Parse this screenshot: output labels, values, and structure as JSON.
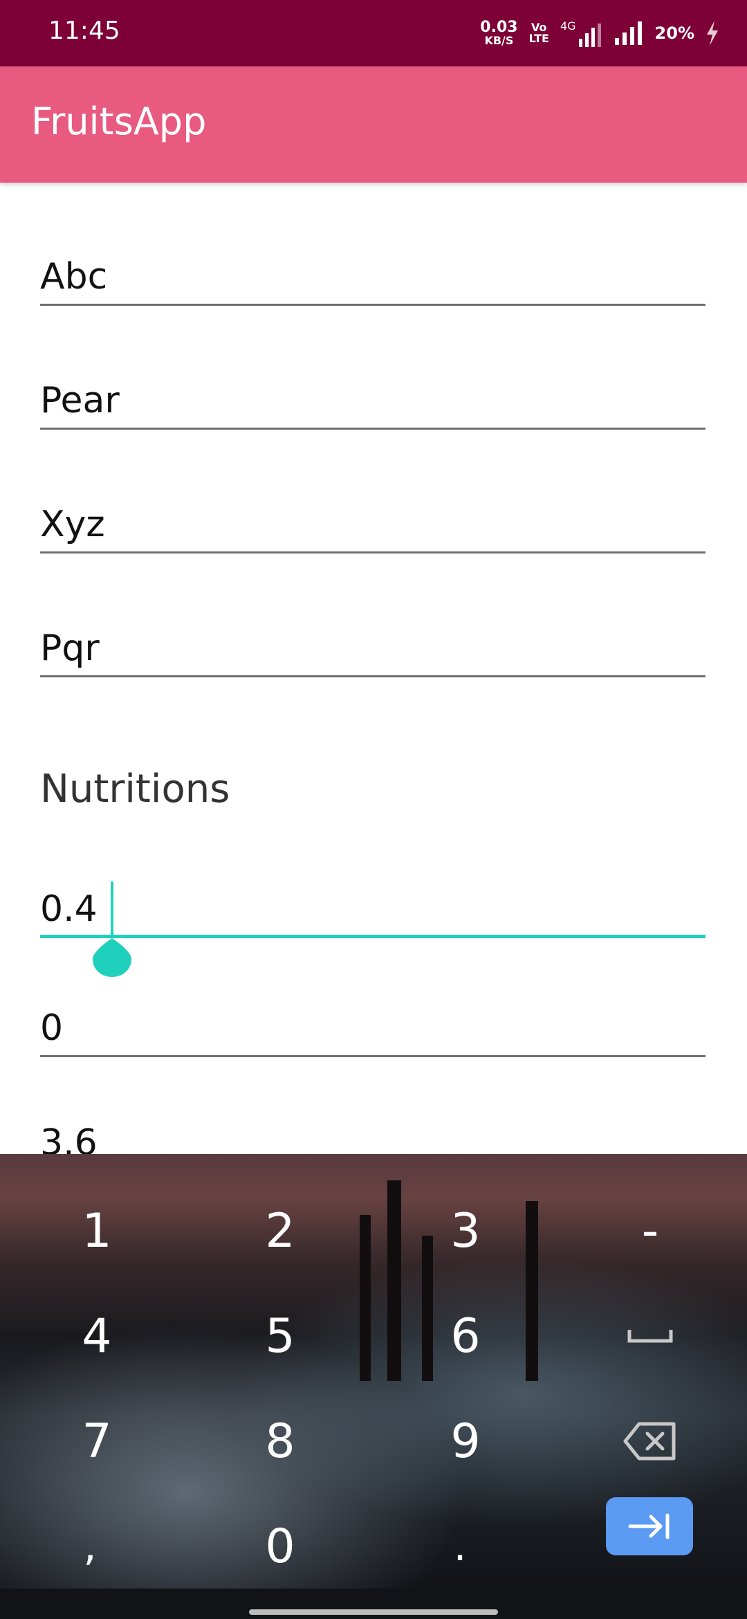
{
  "status_bar": {
    "time": "11:45",
    "net_speed_value": "0.03",
    "net_speed_unit": "KB/S",
    "volte_top": "Vo",
    "volte_bottom": "LTE",
    "network_type": "4G",
    "battery": "20%"
  },
  "app_bar": {
    "title": "FruitsApp"
  },
  "form": {
    "fields": [
      {
        "value": "Abc"
      },
      {
        "value": "Pear"
      },
      {
        "value": "Xyz"
      },
      {
        "value": "Pqr"
      }
    ],
    "section_title": "Nutritions",
    "nutrition_fields": [
      {
        "value": "0.4"
      },
      {
        "value": "0"
      },
      {
        "value": "3.6"
      }
    ]
  },
  "keyboard": {
    "rows": [
      [
        "1",
        "2",
        "3",
        "-"
      ],
      [
        "4",
        "5",
        "6",
        "␣"
      ],
      [
        "7",
        "8",
        "9",
        "⌫"
      ],
      [
        ",",
        "0",
        ".",
        "⇥"
      ]
    ]
  },
  "colors": {
    "status_bar": "#7d0036",
    "app_bar": "#e85a80",
    "accent": "#1fd1bd",
    "enter_key": "#5a9af2"
  }
}
